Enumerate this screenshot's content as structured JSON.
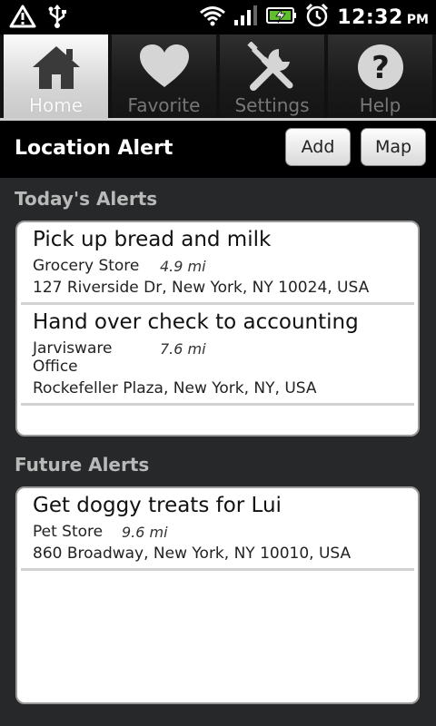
{
  "status_bar": {
    "left_icons": [
      "warning-icon",
      "usb-icon"
    ],
    "right_icons": [
      "wifi-icon",
      "signal-icon",
      "battery-charging-icon",
      "alarm-icon"
    ],
    "time": "12:32",
    "ampm": "PM"
  },
  "tabs": [
    {
      "label": "Home",
      "icon": "home-icon",
      "active": true
    },
    {
      "label": "Favorite",
      "icon": "heart-icon",
      "active": false
    },
    {
      "label": "Settings",
      "icon": "tools-icon",
      "active": false
    },
    {
      "label": "Help",
      "icon": "help-icon",
      "active": false
    }
  ],
  "titlebar": {
    "title": "Location Alert",
    "add_label": "Add",
    "map_label": "Map"
  },
  "todays": {
    "header": "Today's Alerts",
    "items": [
      {
        "title": "Pick up bread and milk",
        "place": "Grocery Store",
        "distance": "4.9 mi",
        "address": "127 Riverside Dr, New York, NY 10024, USA"
      },
      {
        "title": "Hand over check to accounting",
        "place": "Jarvisware Office",
        "distance": "7.6 mi",
        "address": "Rockefeller Plaza, New York, NY, USA"
      }
    ]
  },
  "future": {
    "header": "Future Alerts",
    "items": [
      {
        "title": "Get doggy treats for Lui",
        "place": "Pet Store",
        "distance": "9.6 mi",
        "address": "860 Broadway, New York, NY 10010, USA"
      }
    ]
  },
  "colors": {
    "background": "#26282a",
    "section_header": "#b9b9b9",
    "status_bar": "#000000"
  }
}
